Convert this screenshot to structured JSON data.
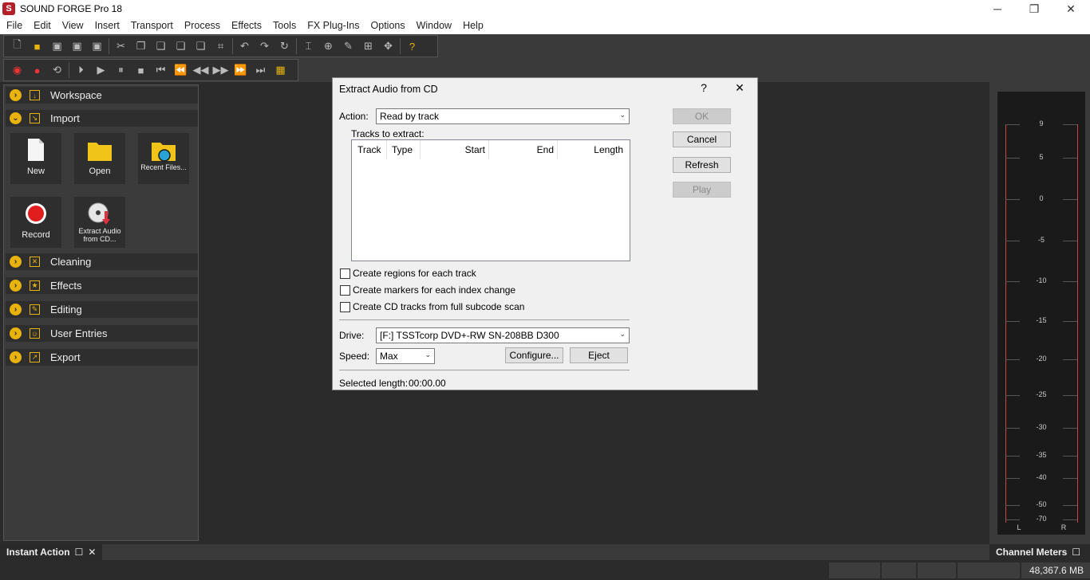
{
  "app": {
    "title": "SOUND FORGE Pro 18",
    "logo_letter": "S"
  },
  "window_controls": {
    "minimize": "─",
    "restore": "❐",
    "close": "✕"
  },
  "menu": [
    "File",
    "Edit",
    "View",
    "Insert",
    "Transport",
    "Process",
    "Effects",
    "Tools",
    "FX Plug-Ins",
    "Options",
    "Window",
    "Help"
  ],
  "left_panel": {
    "sections": {
      "workspace": "Workspace",
      "import": "Import",
      "cleaning": "Cleaning",
      "effects": "Effects",
      "editing": "Editing",
      "user_entries": "User Entries",
      "export": "Export"
    },
    "tiles": {
      "new": "New",
      "open": "Open",
      "recent": "Recent Files...",
      "record": "Record",
      "extract": "Extract Audio from CD..."
    }
  },
  "dialog": {
    "title": "Extract Audio from CD",
    "help": "?",
    "close": "✕",
    "action_label": "Action:",
    "action_value": "Read by track",
    "tracks_label": "Tracks to extract:",
    "columns": [
      "Track",
      "Type",
      "Start",
      "End",
      "Length"
    ],
    "checkboxes": {
      "regions": "Create regions for each track",
      "markers": "Create markers for each index change",
      "cd_tracks": "Create CD tracks from full subcode scan"
    },
    "drive_label": "Drive:",
    "drive_value": "[F:] TSSTcorp DVD+-RW SN-208BB D300",
    "speed_label": "Speed:",
    "speed_value": "Max",
    "configure": "Configure...",
    "eject": "Eject",
    "selected_length_label": "Selected length:",
    "selected_length_value": "00:00.00",
    "buttons": {
      "ok": "OK",
      "cancel": "Cancel",
      "refresh": "Refresh",
      "play": "Play"
    }
  },
  "meters": {
    "ticks": [
      "9",
      "5",
      "0",
      "-5",
      "-10",
      "-15",
      "-20",
      "-25",
      "-30",
      "-35",
      "-40",
      "-50",
      "-70"
    ],
    "left": "L",
    "right": "R"
  },
  "bottom": {
    "instant_action": "Instant Action",
    "channel_meters": "Channel Meters",
    "status_space": "48,367.6 MB"
  }
}
